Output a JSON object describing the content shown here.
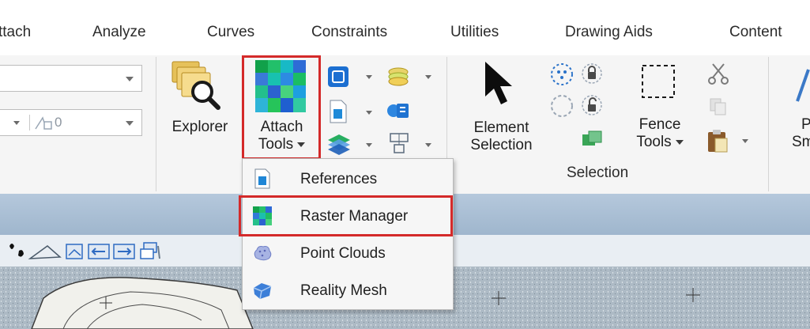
{
  "tabs": [
    "ttach",
    "Analyze",
    "Curves",
    "Constraints",
    "Utilities",
    "Drawing Aids",
    "Content"
  ],
  "ribbon": {
    "level_field": {
      "value": "0"
    },
    "explorer_label": "Explorer",
    "attach_tools_label_1": "Attach",
    "attach_tools_label_2": "Tools",
    "element_selection_label_1": "Element",
    "element_selection_label_2": "Selection",
    "fence_tools_label_1": "Fence",
    "fence_tools_label_2": "Tools",
    "selection_group_label": "Selection",
    "clipped_label_1": "P",
    "clipped_label_2": "Sm"
  },
  "attach_menu": {
    "items": [
      {
        "label": "References",
        "icon": "references-icon"
      },
      {
        "label": "Raster Manager",
        "icon": "raster-manager-icon"
      },
      {
        "label": "Point Clouds",
        "icon": "point-clouds-icon"
      },
      {
        "label": "Reality Mesh",
        "icon": "reality-mesh-icon"
      }
    ]
  },
  "colors": {
    "highlight": "#d42a2a",
    "ribbon_bg": "#f5f5f5",
    "strip": "#a9bfd4"
  }
}
